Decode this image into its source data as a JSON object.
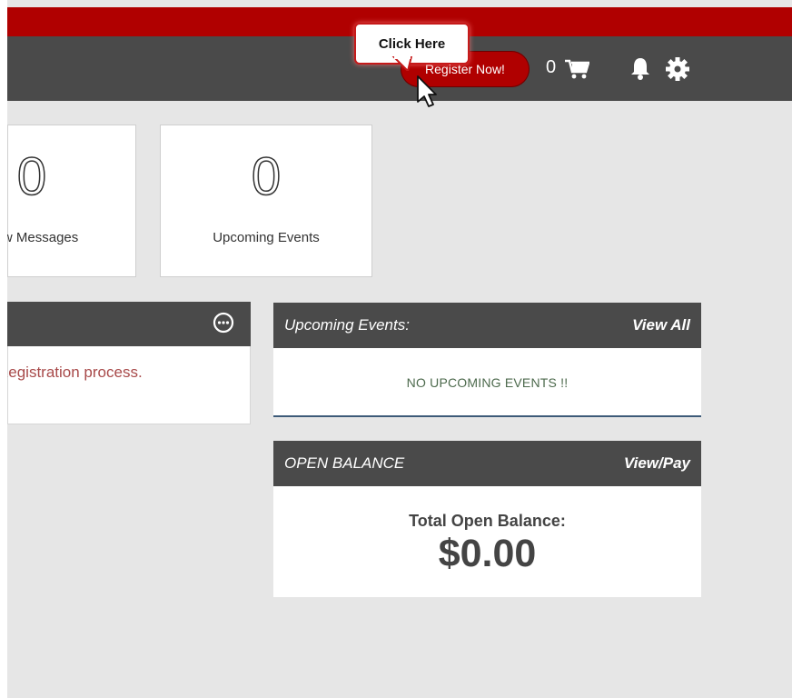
{
  "header": {
    "register_label": "Register Now!",
    "cart_count": "0",
    "icons": [
      "cart-icon",
      "bell-icon",
      "gear-icon"
    ]
  },
  "tooltip": {
    "text": "Click Here"
  },
  "stats": [
    {
      "value": "0",
      "label": "New Messages"
    },
    {
      "value": "0",
      "label": "Upcoming Events"
    }
  ],
  "notice_panel": {
    "text": "Registration process."
  },
  "events_panel": {
    "title": "Upcoming Events:",
    "action": "View All",
    "empty_text": "NO UPCOMING EVENTS !!"
  },
  "balance_panel": {
    "title": "OPEN BALANCE",
    "action": "View/Pay",
    "label": "Total Open Balance:",
    "amount": "$0.00"
  },
  "colors": {
    "brand_red": "#b00000",
    "header_gray": "#4a4a4a",
    "page_bg": "#e6e6e6"
  }
}
